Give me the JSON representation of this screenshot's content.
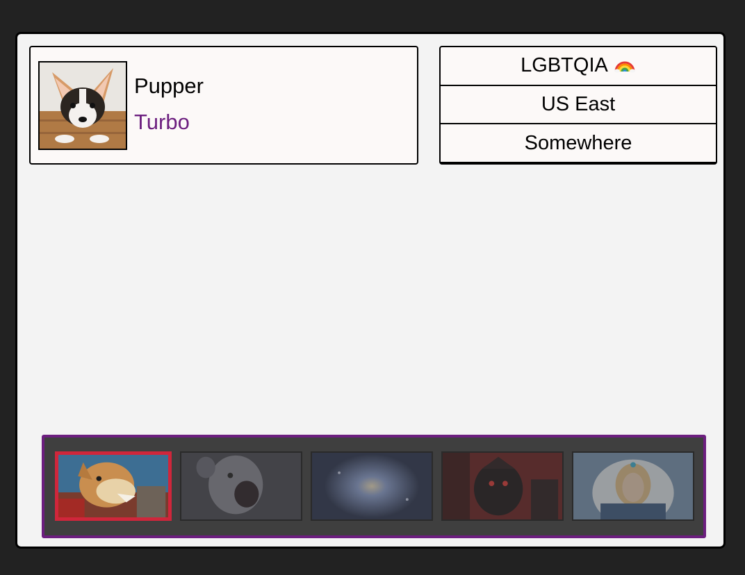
{
  "profile": {
    "name": "Pupper",
    "mode": "Turbo",
    "avatar_icon": "corgi-puppy-photo"
  },
  "tags": {
    "items": [
      {
        "label": "LGBTQIA",
        "icon": "rainbow-icon"
      },
      {
        "label": "US East"
      },
      {
        "label": "Somewhere"
      }
    ]
  },
  "heroes": {
    "selected_index": 0,
    "items": [
      {
        "icon": "hero-armored-beast-portrait",
        "selected": true
      },
      {
        "icon": "hero-undead-ghoul-portrait",
        "selected": false
      },
      {
        "icon": "hero-spirit-orb-portrait",
        "selected": false
      },
      {
        "icon": "hero-dark-knight-portrait",
        "selected": false
      },
      {
        "icon": "hero-ice-maiden-portrait",
        "selected": false
      }
    ]
  },
  "colors": {
    "accent_purple": "#6c1e7f",
    "selected_red": "#d0263b",
    "bar_bg": "#3f3f3f",
    "page_bg": "#222222"
  }
}
